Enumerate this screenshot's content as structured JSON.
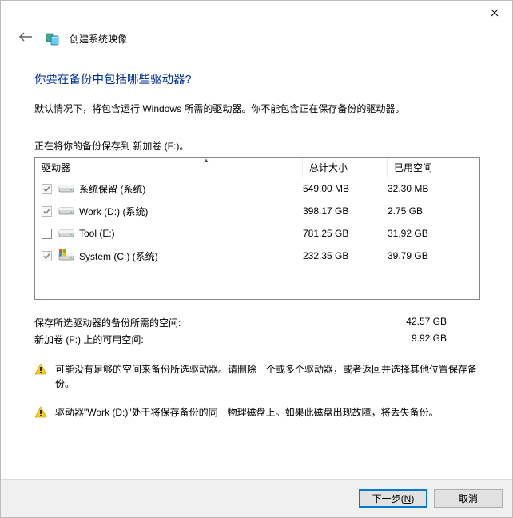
{
  "header": {
    "title": "创建系统映像"
  },
  "heading": "你要在备份中包括哪些驱动器?",
  "description": "默认情况下，将包含运行 Windows 所需的驱动器。你不能包含正在保存备份的驱动器。",
  "saving_line": "正在将你的备份保存到 新加卷 (F:)。",
  "columns": {
    "drive": "驱动器",
    "total": "总计大小",
    "used": "已用空间"
  },
  "drives": [
    {
      "checked": true,
      "disabled": true,
      "icon": "hdd",
      "name": "系统保留 (系统)",
      "total": "549.00 MB",
      "used": "32.30 MB"
    },
    {
      "checked": true,
      "disabled": true,
      "icon": "hdd",
      "name": "Work (D:) (系统)",
      "total": "398.17 GB",
      "used": "2.75 GB"
    },
    {
      "checked": false,
      "disabled": false,
      "icon": "hdd",
      "name": "Tool (E:)",
      "total": "781.25 GB",
      "used": "31.92 GB"
    },
    {
      "checked": true,
      "disabled": true,
      "icon": "winhdd",
      "name": "System (C:) (系统)",
      "total": "232.35 GB",
      "used": "39.79 GB"
    }
  ],
  "summary": {
    "space_required_label": "保存所选驱动器的备份所需的空间:",
    "space_required_value": "42.57 GB",
    "space_available_label": "新加卷 (F:) 上的可用空间:",
    "space_available_value": "9.92 GB"
  },
  "warnings": [
    "可能没有足够的空间来备份所选驱动器。请删除一个或多个驱动器，或者返回并选择其他位置保存备份。",
    "驱动器\"Work (D:)\"处于将保存备份的同一物理磁盘上。如果此磁盘出现故障，将丢失备份。"
  ],
  "buttons": {
    "next": "下一步(",
    "next_mnemonic": "N",
    "next_suffix": ")",
    "cancel": "取消"
  }
}
